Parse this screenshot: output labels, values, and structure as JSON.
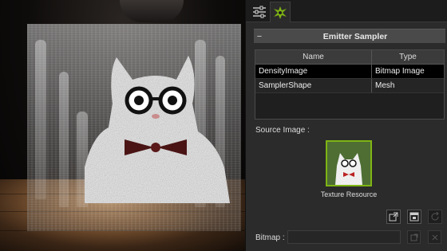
{
  "viewport": {
    "scene": "3d-viewport"
  },
  "tabs": [
    {
      "icon": "sliders-icon",
      "active": false
    },
    {
      "icon": "particle-emitter-icon",
      "active": true
    }
  ],
  "section": {
    "collapse_glyph": "−",
    "title": "Emitter Sampler"
  },
  "table": {
    "headers": [
      "Name",
      "Type"
    ],
    "rows": [
      {
        "name": "DensityImage",
        "type": "Bitmap Image",
        "selected": true
      },
      {
        "name": "SamplerShape",
        "type": "Mesh",
        "selected": false
      }
    ]
  },
  "source": {
    "label": "Source Image :",
    "caption": "Texture Resource"
  },
  "toolbar": {
    "icons": [
      "load-image-icon",
      "open-editor-icon",
      "refresh-icon"
    ]
  },
  "bitmap": {
    "label": "Bitmap :",
    "value": ""
  },
  "colors": {
    "accent": "#7fb414",
    "panel_bg": "#2b2b2b",
    "header_bg": "#4a4a4a"
  }
}
